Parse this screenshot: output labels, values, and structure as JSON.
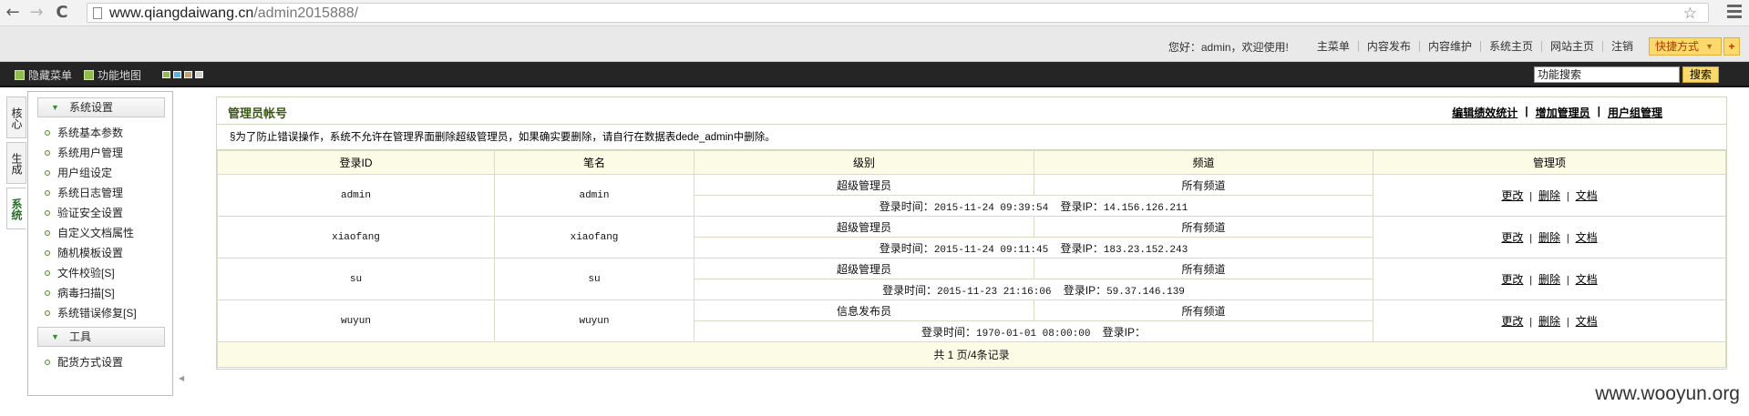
{
  "browser": {
    "back_glyph": "←",
    "forward_glyph": "→",
    "reload_glyph": "C",
    "url_host": "www.qiangdaiwang.cn",
    "url_path": "/admin2015888/",
    "star_glyph": "☆"
  },
  "topbar": {
    "greeting": "您好：admin，欢迎使用!",
    "nav": [
      "主菜单",
      "内容发布",
      "内容维护",
      "系统主页",
      "网站主页",
      "注销"
    ],
    "quick_label": "快捷方式",
    "quick_caret": "▼",
    "quick_plus": "+"
  },
  "toolbar": {
    "hide_menu": "隐藏菜单",
    "function_map": "功能地图",
    "swatch_colors": [
      "#8fbf4a",
      "#5bb3e0",
      "#c79f6a",
      "#cfcfcf"
    ],
    "search_value": "功能搜索",
    "search_button": "搜索"
  },
  "sidebar": {
    "vtabs": [
      "核心",
      "生成",
      "系统"
    ],
    "active_vtab": "系统",
    "groups": [
      {
        "title": "系统设置",
        "items": [
          "系统基本参数",
          "系统用户管理",
          "用户组设定",
          "系统日志管理",
          "验证安全设置",
          "自定义文档属性",
          "随机模板设置",
          "文件校验[S]",
          "病毒扫描[S]",
          "系统错误修复[S]"
        ]
      },
      {
        "title": "工具",
        "items": [
          "配货方式设置"
        ]
      }
    ]
  },
  "main": {
    "title": "管理员帐号",
    "links": [
      "编辑绩效统计",
      "增加管理员",
      "用户组管理"
    ],
    "notice": "§为了防止错误操作，系统不允许在管理界面删除超级管理员，如果确实要删除，请自行在数据表dede_admin中删除。",
    "columns": [
      "登录ID",
      "笔名",
      "级别",
      "频道",
      "管理项"
    ],
    "login_time_label": "登录时间：",
    "login_ip_label": "登录IP：",
    "ops": [
      "更改",
      "删除",
      "文档"
    ],
    "rows": [
      {
        "id": "admin",
        "pen": "admin",
        "level": "超级管理员",
        "channel": "所有频道",
        "time": "2015-11-24 09:39:54",
        "ip": "14.156.126.211"
      },
      {
        "id": "xiaofang",
        "pen": "xiaofang",
        "level": "超级管理员",
        "channel": "所有频道",
        "time": "2015-11-24 09:11:45",
        "ip": "183.23.152.243"
      },
      {
        "id": "su",
        "pen": "su",
        "level": "超级管理员",
        "channel": "所有频道",
        "time": "2015-11-23 21:16:06",
        "ip": "59.37.146.139"
      },
      {
        "id": "wuyun",
        "pen": "wuyun",
        "level": "信息发布员",
        "channel": "所有频道",
        "time": "1970-01-01 08:00:00",
        "ip": ""
      }
    ],
    "footer": "共 1 页/4条记录"
  },
  "watermark": "www.wooyun.org"
}
